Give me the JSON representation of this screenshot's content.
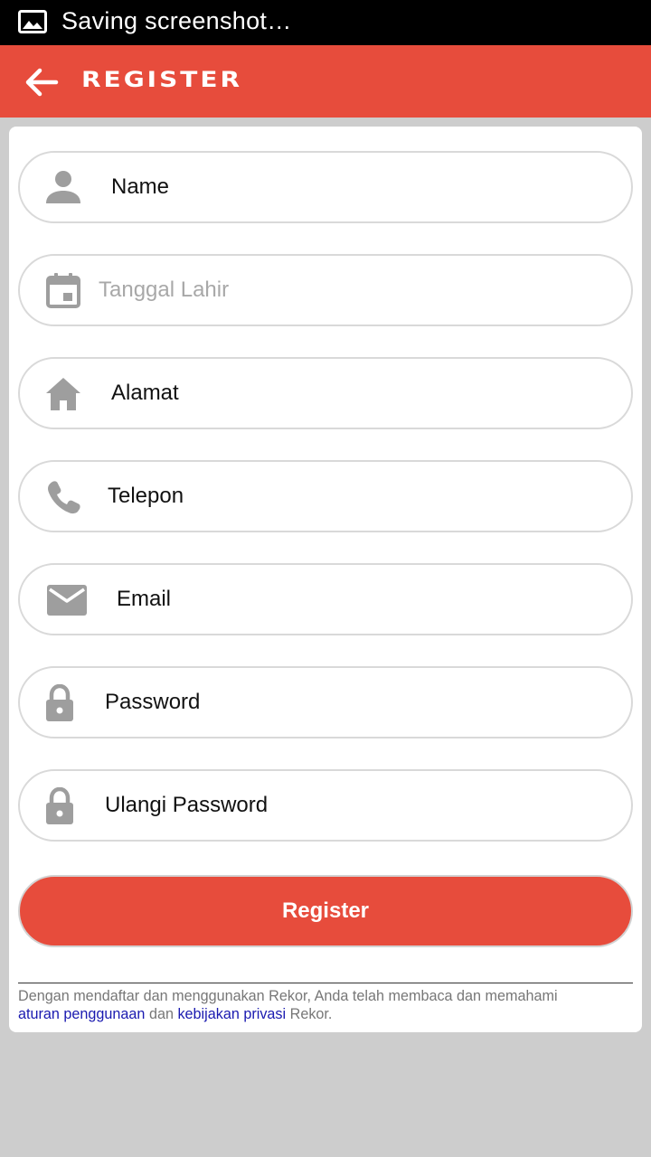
{
  "status_bar": {
    "text": "Saving screenshot…",
    "icon": "image-icon"
  },
  "app_bar": {
    "title": "REGISTER",
    "back_icon": "arrow-back-icon",
    "color": "#e74c3c"
  },
  "form": {
    "fields": [
      {
        "label": "Name",
        "icon": "person-icon",
        "is_placeholder": false
      },
      {
        "label": "Tanggal Lahir",
        "icon": "calendar-icon",
        "is_placeholder": true
      },
      {
        "label": "Alamat",
        "icon": "home-icon",
        "is_placeholder": false
      },
      {
        "label": "Telepon",
        "icon": "phone-icon",
        "is_placeholder": false
      },
      {
        "label": "Email",
        "icon": "mail-icon",
        "is_placeholder": false
      },
      {
        "label": "Password",
        "icon": "lock-icon",
        "is_placeholder": false
      },
      {
        "label": "Ulangi Password",
        "icon": "lock-icon",
        "is_placeholder": false
      }
    ],
    "register_label": "Register"
  },
  "terms": {
    "prefix": "Dengan mendaftar dan menggunakan Rekor, Anda telah membaca dan memahami",
    "link1": "aturan penggunaan",
    "middle": "dan",
    "link2": "kebijakan privasi",
    "suffix": "Rekor."
  },
  "colors": {
    "accent": "#e74c3c",
    "link": "#1a1ab0",
    "icon_gray": "#9e9e9e",
    "background": "#cdcdcd"
  }
}
